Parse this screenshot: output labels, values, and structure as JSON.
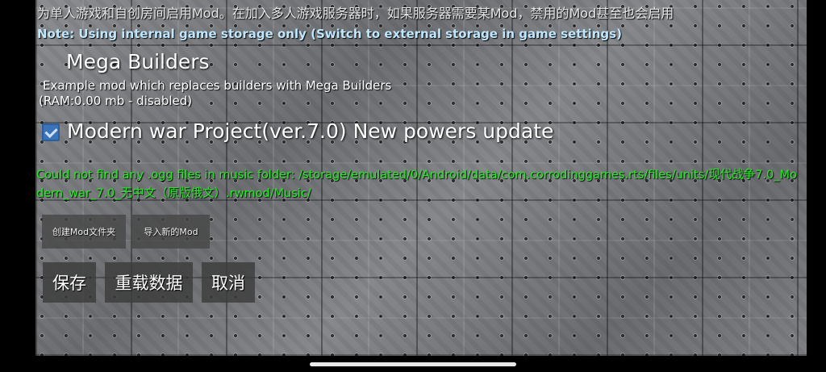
{
  "notices": {
    "top_text": "为单人游戏和自创房间启用Mod。在加入多人游戏服务器时，如果服务器需要某Mod，禁用的Mod甚至也会启用",
    "storage_note": "Note: Using internal game storage only (Switch to external storage in game settings)"
  },
  "mods": [
    {
      "title": "Mega Builders",
      "description": "Example mod which replaces builders with Mega Builders",
      "status": "(RAM:0.00 mb - disabled)",
      "enabled": false
    },
    {
      "title": "Modern war Project(ver.7.0) New powers update",
      "error": "Could not find any .ogg files in music folder: /storage/emulated/0/Android/data/com.corrodinggames.rts/files/units/现代战争7.0_Modern_war_7.0_无中文（原版俄文）.rwmod/Music/",
      "enabled": true
    }
  ],
  "actions": {
    "create_folder": "创建Mod文件夹",
    "import_mod": "导入新的Mod",
    "save": "保存",
    "reload": "重载数据",
    "cancel": "取消"
  },
  "icons": {
    "checkbox_checked": "checkbox-checked-icon",
    "home_indicator": "home-indicator"
  },
  "colors": {
    "error_text": "#22ee22",
    "note_text": "#bfe8ff",
    "checkbox_accent": "#3b73b9"
  }
}
